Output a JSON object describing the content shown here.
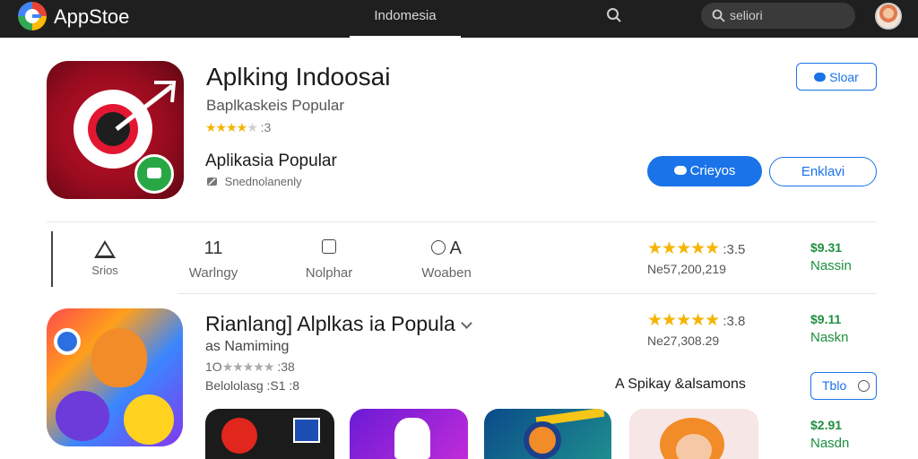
{
  "topbar": {
    "app_name": "AppStoe",
    "region_tab": "Indomesia",
    "search_placeholder": "seliori"
  },
  "hero": {
    "title": "Aplking Indoosai",
    "subtitle": "Baplkaskeis Popular",
    "rating_value": ":3",
    "category": "Aplikasia Popular",
    "developer": "Snednolanenly",
    "share_label": "Sloar",
    "primary_button": "Crieyos",
    "secondary_button": "Enklavi"
  },
  "stats": {
    "warning_label": "Srios",
    "count_value": "11",
    "count_label": "Warlngy",
    "size_label": "Nolphar",
    "time_value": "A",
    "time_label": "Woaben"
  },
  "ratings": [
    {
      "value": ":3.5",
      "count": "Ne57,200,219"
    },
    {
      "value": ":3.8",
      "count": "Ne27,308.29"
    }
  ],
  "prices": [
    {
      "amount": "$9.31",
      "label": "Nassin"
    },
    {
      "amount": "$9.11",
      "label": "Naskn"
    },
    {
      "amount": "$2.91",
      "label": "Nasdn"
    }
  ],
  "game": {
    "title": "Rianlang] Alplkas ia Popula",
    "subtitle": "as Namiming",
    "rating_prefix": "1O",
    "rating_value": ":38",
    "meta": "Belololasg :S1 :8",
    "promo_text": "A Spikay &alsamons",
    "small_button": "Tblo"
  },
  "colors": {
    "accent": "#1a73e8",
    "price_green": "#1e8e3e",
    "star": "#f5b400",
    "topbar": "#1f1f1f"
  }
}
